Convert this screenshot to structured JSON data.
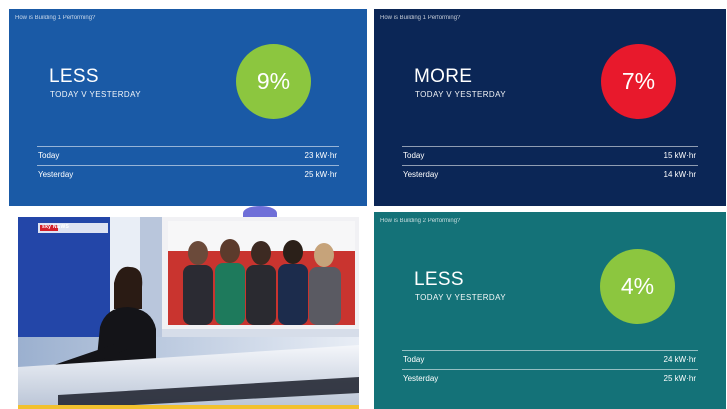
{
  "panels": [
    {
      "caption": "How is Building 1 Performing?",
      "headline": "LESS",
      "subline": "TODAY V YESTERDAY",
      "percent": "9%",
      "percent_color": "#8cc63f",
      "background": "#1a5aa6",
      "rows": [
        {
          "label": "Today",
          "value": "23 kW·hr"
        },
        {
          "label": "Yesterday",
          "value": "25 kW·hr"
        }
      ]
    },
    {
      "caption": "How is Building 1 Performing?",
      "headline": "MORE",
      "subline": "TODAY V YESTERDAY",
      "percent": "7%",
      "percent_color": "#e8192c",
      "background": "#0b2656",
      "rows": [
        {
          "label": "Today",
          "value": "15 kW·hr"
        },
        {
          "label": "Yesterday",
          "value": "14 kW·hr"
        }
      ]
    },
    {
      "caption": "How is Building 2 Performing?",
      "headline": "LESS",
      "subline": "TODAY V YESTERDAY",
      "percent": "4%",
      "percent_color": "#8cc63f",
      "background": "#147278",
      "rows": [
        {
          "label": "Today",
          "value": "24 kW·hr"
        },
        {
          "label": "Yesterday",
          "value": "25 kW·hr"
        }
      ]
    }
  ],
  "tv": {
    "channel_logo": "sky NEWS",
    "colors": {
      "studio_blue": "#2346a8",
      "studio_red": "#d21f2b",
      "screen_bg": "#c9342f"
    }
  }
}
